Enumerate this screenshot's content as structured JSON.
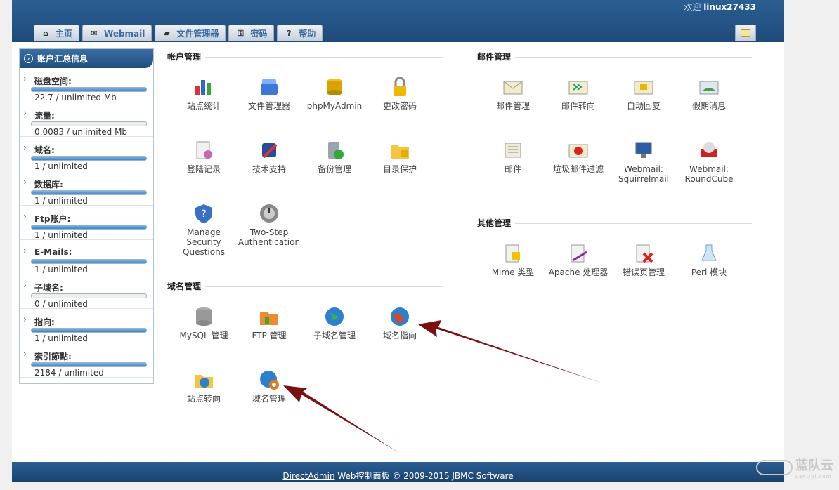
{
  "header": {
    "welcome_prefix": "欢迎",
    "username": "linux27433"
  },
  "tabs": [
    {
      "label": "主页",
      "icon": "home-icon"
    },
    {
      "label": "Webmail",
      "icon": "mail-icon"
    },
    {
      "label": "文件管理器",
      "icon": "folder-icon"
    },
    {
      "label": "密码",
      "icon": "key-icon"
    },
    {
      "label": "帮助",
      "icon": "help-icon"
    }
  ],
  "sidebar": {
    "title": "账户汇总信息",
    "stats": [
      {
        "label": "磁盘空间:",
        "value": "22.7 / unlimited Mb",
        "fill": 1.0
      },
      {
        "label": "流量:",
        "value": "0.0083 / unlimited Mb",
        "fill": 0.0
      },
      {
        "label": "域名:",
        "value": "1 / unlimited",
        "fill": 1.0
      },
      {
        "label": "数据库:",
        "value": "1 / unlimited",
        "fill": 1.0
      },
      {
        "label": "Ftp账户:",
        "value": "1 / unlimited",
        "fill": 1.0
      },
      {
        "label": "E-Mails:",
        "value": "1 / unlimited",
        "fill": 1.0
      },
      {
        "label": "子域名:",
        "value": "0 / unlimited",
        "fill": 0.0
      },
      {
        "label": "指向:",
        "value": "1 / unlimited",
        "fill": 1.0
      },
      {
        "label": "索引節點:",
        "value": "2184 / unlimited",
        "fill": 1.0
      }
    ]
  },
  "sections": {
    "account": {
      "title": "帐户管理",
      "items": [
        {
          "label": "站点统计",
          "icon": "stats-icon"
        },
        {
          "label": "文件管理器",
          "icon": "file-manager-icon"
        },
        {
          "label": "phpMyAdmin",
          "icon": "phpmyadmin-icon"
        },
        {
          "label": "更改密码",
          "icon": "lock-icon"
        },
        {
          "label": "登陆记录",
          "icon": "login-log-icon"
        },
        {
          "label": "技术支持",
          "icon": "support-icon"
        },
        {
          "label": "备份管理",
          "icon": "backup-icon"
        },
        {
          "label": "目录保护",
          "icon": "folder-lock-icon"
        },
        {
          "label": "Manage Security Questions",
          "icon": "security-question-icon"
        },
        {
          "label": "Two-Step Authentication",
          "icon": "two-step-icon"
        }
      ]
    },
    "domain": {
      "title": "域名管理",
      "items": [
        {
          "label": "MySQL 管理",
          "icon": "database-icon"
        },
        {
          "label": "FTP 管理",
          "icon": "ftp-folder-icon"
        },
        {
          "label": "子域名管理",
          "icon": "globe-icon"
        },
        {
          "label": "域名指向",
          "icon": "globe-pointer-icon"
        },
        {
          "label": "站点转向",
          "icon": "redirect-folder-icon"
        },
        {
          "label": "域名管理",
          "icon": "globe-gear-icon"
        }
      ]
    },
    "mail": {
      "title": "邮件管理",
      "items": [
        {
          "label": "邮件管理",
          "icon": "envelope-icon"
        },
        {
          "label": "邮件转向",
          "icon": "forward-envelope-icon"
        },
        {
          "label": "自动回复",
          "icon": "autoreply-icon"
        },
        {
          "label": "假期消息",
          "icon": "vacation-icon"
        },
        {
          "label": "邮件",
          "icon": "mail-list-icon"
        },
        {
          "label": "垃圾邮件过滤",
          "icon": "spam-filter-icon"
        },
        {
          "label": "Webmail: Squirrelmail",
          "icon": "squirrelmail-icon"
        },
        {
          "label": "Webmail: RoundCube",
          "icon": "roundcube-icon"
        }
      ]
    },
    "other": {
      "title": "其他管理",
      "items": [
        {
          "label": "Mime 类型",
          "icon": "mime-icon"
        },
        {
          "label": "Apache 处理器",
          "icon": "apache-handler-icon"
        },
        {
          "label": "错误页管理",
          "icon": "error-page-icon"
        },
        {
          "label": "Perl 模块",
          "icon": "perl-icon"
        }
      ]
    }
  },
  "footer": {
    "link": "DirectAdmin",
    "text": " Web控制面板 © 2009-2015 JBMC Software"
  },
  "watermark": {
    "name": "蓝队云",
    "sub": "LanDui.com"
  },
  "colors": {
    "header": "#1e4a79",
    "arrow": "#7a1010"
  }
}
